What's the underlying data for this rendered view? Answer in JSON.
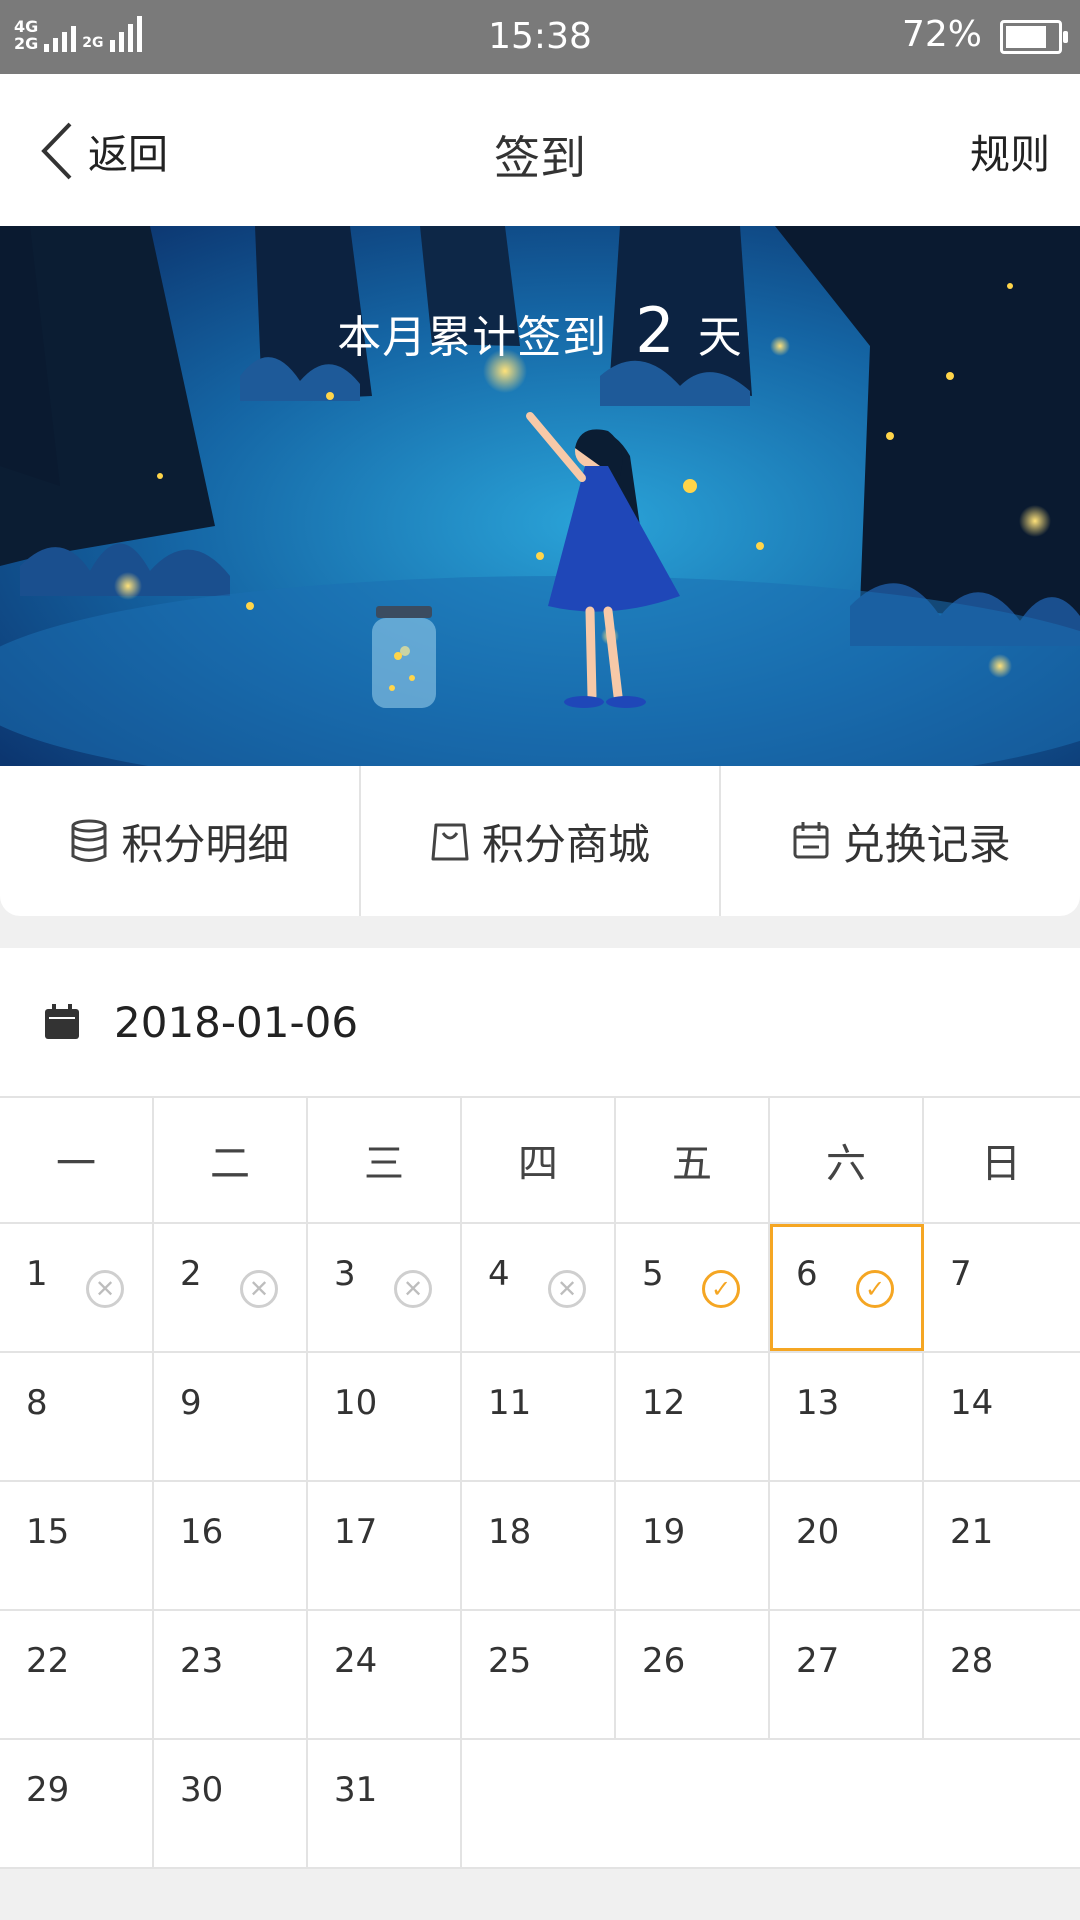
{
  "status_bar": {
    "network_top": "4G",
    "network_bottom": "2G",
    "network_mini": "2G",
    "time": "15:38",
    "battery_percent": "72%",
    "battery_level": 0.72
  },
  "nav": {
    "back_label": "返回",
    "title": "签到",
    "rules_label": "规则"
  },
  "banner": {
    "prefix": "本月累计签到",
    "count": "2",
    "suffix": "天"
  },
  "actions": [
    {
      "label": "积分明细",
      "icon": "coin-stack-icon"
    },
    {
      "label": "积分商城",
      "icon": "shopping-bag-icon"
    },
    {
      "label": "兑换记录",
      "icon": "calendar-record-icon"
    }
  ],
  "date": {
    "value": "2018-01-06",
    "icon": "calendar-icon"
  },
  "calendar": {
    "weekdays": [
      "一",
      "二",
      "三",
      "四",
      "五",
      "六",
      "日"
    ],
    "weeks": [
      [
        {
          "day": "1",
          "status": "missed"
        },
        {
          "day": "2",
          "status": "missed"
        },
        {
          "day": "3",
          "status": "missed"
        },
        {
          "day": "4",
          "status": "missed"
        },
        {
          "day": "5",
          "status": "checked"
        },
        {
          "day": "6",
          "status": "checked",
          "today": true
        },
        {
          "day": "7",
          "status": ""
        }
      ],
      [
        {
          "day": "8"
        },
        {
          "day": "9"
        },
        {
          "day": "10"
        },
        {
          "day": "11"
        },
        {
          "day": "12"
        },
        {
          "day": "13"
        },
        {
          "day": "14"
        }
      ],
      [
        {
          "day": "15"
        },
        {
          "day": "16"
        },
        {
          "day": "17"
        },
        {
          "day": "18"
        },
        {
          "day": "19"
        },
        {
          "day": "20"
        },
        {
          "day": "21"
        }
      ],
      [
        {
          "day": "22"
        },
        {
          "day": "23"
        },
        {
          "day": "24"
        },
        {
          "day": "25"
        },
        {
          "day": "26"
        },
        {
          "day": "27"
        },
        {
          "day": "28"
        }
      ],
      [
        {
          "day": "29"
        },
        {
          "day": "30"
        },
        {
          "day": "31"
        },
        {
          "day": ""
        },
        {
          "day": ""
        },
        {
          "day": ""
        },
        {
          "day": ""
        }
      ]
    ],
    "colors": {
      "checked": "#f5a623",
      "missed": "#cfcfcf"
    }
  }
}
